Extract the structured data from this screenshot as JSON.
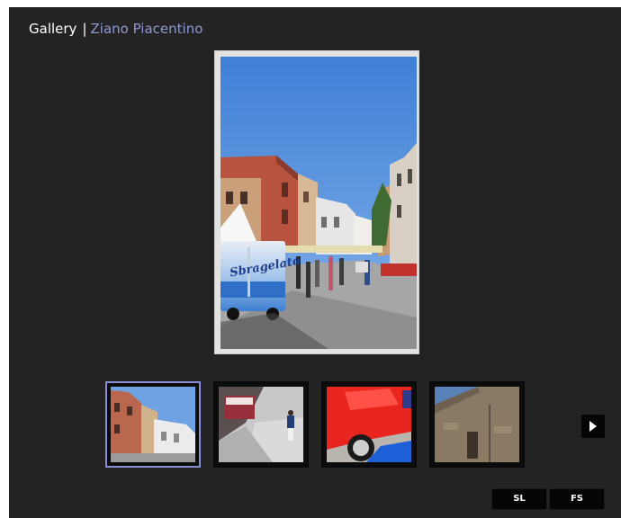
{
  "header": {
    "gallery_label": "Gallery",
    "separator": "|",
    "album_title": "Ziano Piacentino"
  },
  "main_image": {
    "van_text": "Sbragelato"
  },
  "thumbnails": [
    {
      "subject": "street with buildings",
      "selected": true
    },
    {
      "subject": "person walking near cart",
      "selected": false
    },
    {
      "subject": "red vintage car",
      "selected": false
    },
    {
      "subject": "stone building facade",
      "selected": false
    }
  ],
  "controls": {
    "slideshow_label": "SL",
    "fullscreen_label": "FS",
    "next_icon": "play-right-icon"
  },
  "colors": {
    "background": "#232323",
    "album_link": "#8f97d2",
    "selected_border": "#8a8fd6"
  }
}
